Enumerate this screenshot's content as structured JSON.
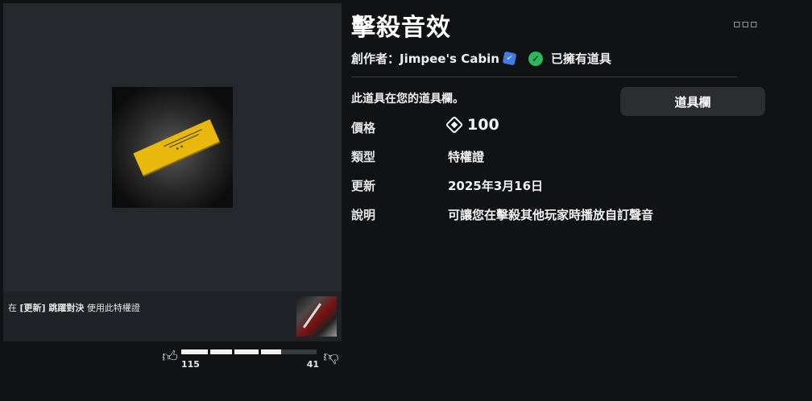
{
  "item": {
    "title": "擊殺音效",
    "more_label": "▫▫▫",
    "creator_label": "創作者：",
    "creator_name": "Jimpee's Cabin",
    "verified_icon": "verified-badge-icon",
    "owned_label": "已擁有道具",
    "owned_note": "此道具在您的道具欄。",
    "inventory_button_label": "道具欄"
  },
  "details": {
    "price_label": "價格",
    "price_value": "100",
    "type_label": "類型",
    "type_value": "特權證",
    "updated_label": "更新",
    "updated_value": "2025年3月16日",
    "description_label": "說明",
    "description_value": "可讓您在擊殺其他玩家時播放自訂聲音"
  },
  "experience": {
    "prefix": "在",
    "name": "[更新] 跳躍對決",
    "suffix": "使用此特權證"
  },
  "votes": {
    "up_count": "115",
    "down_count": "41",
    "up_fraction": 0.737,
    "up_icon": "thumbs-up-icon",
    "down_icon": "thumbs-down-icon"
  },
  "colors": {
    "background": "#111214",
    "panel": "#25282d",
    "owned_green": "#2db85c",
    "verified_blue": "#3f7ce8",
    "ticket_yellow": "#e8b90c"
  }
}
